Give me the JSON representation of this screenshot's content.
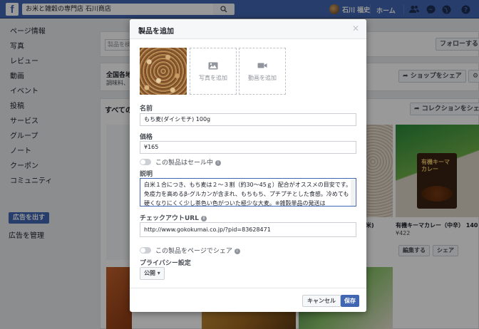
{
  "topbar": {
    "search_value": "お米と雑穀の専門店 石川商店",
    "user_name": "石川 福史",
    "home_label": "ホーム",
    "icons": [
      "friends-icon",
      "messenger-icon",
      "globe-icon",
      "help-icon"
    ]
  },
  "sidebar": {
    "items": [
      "ページ情報",
      "写真",
      "レビュー",
      "動画",
      "イベント",
      "投稿",
      "サービス",
      "グループ",
      "ノート",
      "クーポン",
      "コミュニティ"
    ],
    "ad_button": "広告を出す",
    "manage_ads": "広告を管理"
  },
  "background": {
    "search_placeholder": "製品を検",
    "follow_label": "フォローする",
    "store_title": "全国各地",
    "store_sub": "調味料、",
    "share_shop": "ショップをシェア",
    "all_label": "すべての",
    "collection_share": "コレクションをシェア",
    "product_name_partial": "米)",
    "product_name": "有機キーマカレー（中辛） 140",
    "product_price": "¥422",
    "edit_btn": "編集する",
    "share_btn": "シェア",
    "curry_package_text": "有機キーマカレー"
  },
  "modal": {
    "title": "製品を追加",
    "add_photo": "写真を追加",
    "add_video": "動画を追加",
    "name_label": "名前",
    "name_value": "もち麦(ダイシモチ) 100g",
    "price_label": "価格",
    "price_value": "¥165",
    "sale_label": "この製品はセール中",
    "desc_label": "説明",
    "desc_value": "白米１合につき、もち麦は２〜３割（約30〜45ｇ）配合がオススメの目安です。免疫力を高めるβ-グルカンが含まれ、もちもち、プチプチとした食感。冷めても硬くなりにくく少し茶色い色がついた極少な大麦。※雑穀単品の発送は",
    "checkout_label": "チェックアウトURL",
    "checkout_value": "http://www.gokokumai.co.jp/?pid=83628471",
    "share_page_label": "この製品をページでシェア",
    "privacy_label": "プライバシー設定",
    "privacy_value": "公開",
    "cancel": "キャンセル",
    "save": "保存"
  },
  "colors": {
    "brand": "#4267b2",
    "overlay": "rgba(0,0,0,0.4)"
  }
}
